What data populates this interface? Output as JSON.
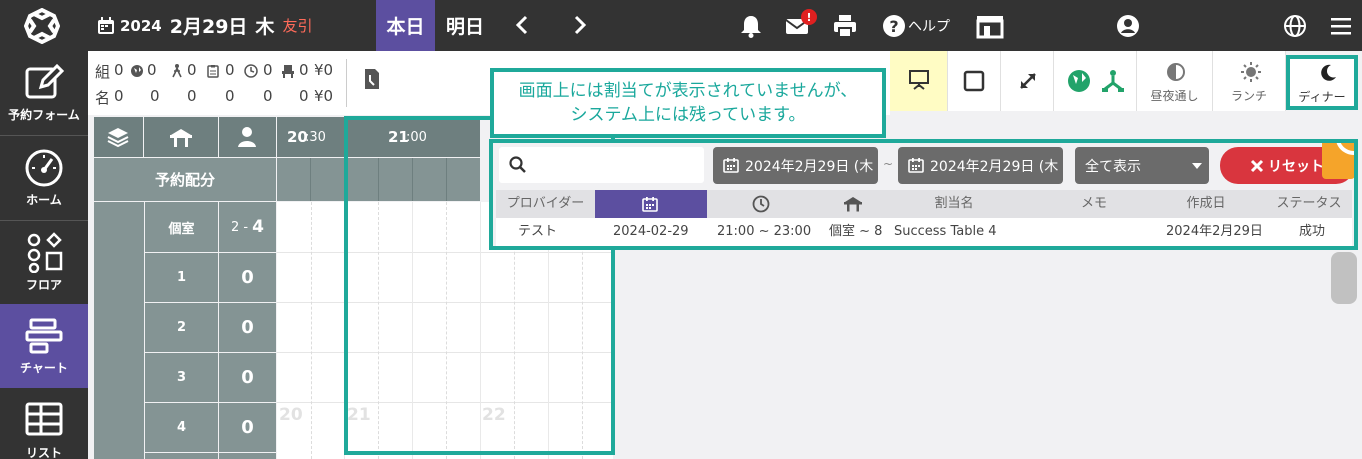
{
  "topbar": {
    "year": "2024",
    "month_day": "2月29日",
    "weekday": "木",
    "rokuyo": "友引",
    "today_label": "本日",
    "tomorrow_label": "明日",
    "help_label": "ヘルプ",
    "mail_badge": "!"
  },
  "sidebar": {
    "items": [
      {
        "label": "予約フォーム",
        "icon": "edit-icon"
      },
      {
        "label": "ホーム",
        "icon": "dashboard-icon"
      },
      {
        "label": "フロア",
        "icon": "floor-icon"
      },
      {
        "label": "チャート",
        "icon": "chart-icon"
      },
      {
        "label": "リスト",
        "icon": "table-icon"
      }
    ]
  },
  "stats": {
    "row1_label": "組",
    "row2_label": "名",
    "row1_values": [
      "0",
      "0",
      "0",
      "0",
      "0",
      "0",
      "¥0"
    ],
    "row2_values": [
      "0",
      "0",
      "0",
      "0",
      "0",
      "0",
      "¥0"
    ]
  },
  "toolbar": {
    "day_night_label": "昼夜通し",
    "lunch_label": "ランチ",
    "dinner_label": "ディナー"
  },
  "chart": {
    "allocation_label": "予約配分",
    "time_2030": "20",
    "time_2030_min": ":30",
    "time_2100": "21",
    "time_2100_min": ":00",
    "room_label": "個室",
    "room_range_low": "2 -",
    "room_range_high": "4",
    "rows": [
      {
        "label": "1",
        "value": "0"
      },
      {
        "label": "2",
        "value": "0"
      },
      {
        "label": "3",
        "value": "0"
      },
      {
        "label": "4",
        "value": "0"
      }
    ],
    "ghost_hours": [
      "20",
      "21",
      "22"
    ]
  },
  "annotation": {
    "line1": "画面上には割当てが表示されていませんが、",
    "line2": "システム上には残っています。"
  },
  "panel": {
    "search_placeholder": "",
    "date_from": "2024年2月29日 (木",
    "date_to": "2024年2月29日 (木",
    "tilde": "~",
    "display_select": "全て表示",
    "reset_label": "リセット",
    "columns": [
      "プロバイダー",
      "",
      "",
      "",
      "割当名",
      "メモ",
      "作成日",
      "ステータス"
    ],
    "row": {
      "provider": "テスト",
      "date": "2024-02-29",
      "time": "21:00 ~ 23:00",
      "seat": "個室 ~ 8",
      "assign_name": "Success Table 4",
      "memo": "",
      "created": "2024年2月29日",
      "status": "成功"
    }
  },
  "colors": {
    "accent": "#5c4fa0",
    "annotation": "#1fa99a",
    "reset": "#d9353e",
    "topbar": "#333333"
  }
}
